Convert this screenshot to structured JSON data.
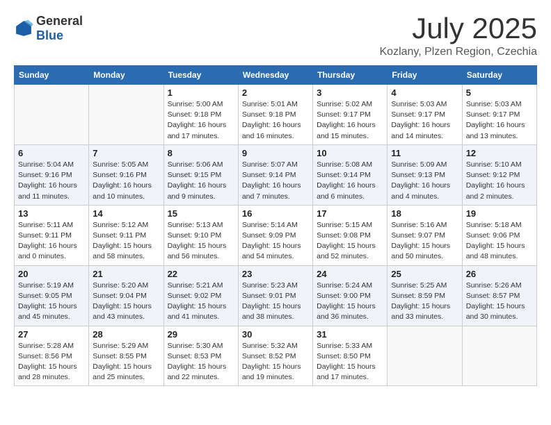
{
  "header": {
    "logo_general": "General",
    "logo_blue": "Blue",
    "month_title": "July 2025",
    "location": "Kozlany, Plzen Region, Czechia"
  },
  "weekdays": [
    "Sunday",
    "Monday",
    "Tuesday",
    "Wednesday",
    "Thursday",
    "Friday",
    "Saturday"
  ],
  "weeks": [
    [
      {
        "day": "",
        "details": ""
      },
      {
        "day": "",
        "details": ""
      },
      {
        "day": "1",
        "details": "Sunrise: 5:00 AM\nSunset: 9:18 PM\nDaylight: 16 hours\nand 17 minutes."
      },
      {
        "day": "2",
        "details": "Sunrise: 5:01 AM\nSunset: 9:18 PM\nDaylight: 16 hours\nand 16 minutes."
      },
      {
        "day": "3",
        "details": "Sunrise: 5:02 AM\nSunset: 9:17 PM\nDaylight: 16 hours\nand 15 minutes."
      },
      {
        "day": "4",
        "details": "Sunrise: 5:03 AM\nSunset: 9:17 PM\nDaylight: 16 hours\nand 14 minutes."
      },
      {
        "day": "5",
        "details": "Sunrise: 5:03 AM\nSunset: 9:17 PM\nDaylight: 16 hours\nand 13 minutes."
      }
    ],
    [
      {
        "day": "6",
        "details": "Sunrise: 5:04 AM\nSunset: 9:16 PM\nDaylight: 16 hours\nand 11 minutes."
      },
      {
        "day": "7",
        "details": "Sunrise: 5:05 AM\nSunset: 9:16 PM\nDaylight: 16 hours\nand 10 minutes."
      },
      {
        "day": "8",
        "details": "Sunrise: 5:06 AM\nSunset: 9:15 PM\nDaylight: 16 hours\nand 9 minutes."
      },
      {
        "day": "9",
        "details": "Sunrise: 5:07 AM\nSunset: 9:14 PM\nDaylight: 16 hours\nand 7 minutes."
      },
      {
        "day": "10",
        "details": "Sunrise: 5:08 AM\nSunset: 9:14 PM\nDaylight: 16 hours\nand 6 minutes."
      },
      {
        "day": "11",
        "details": "Sunrise: 5:09 AM\nSunset: 9:13 PM\nDaylight: 16 hours\nand 4 minutes."
      },
      {
        "day": "12",
        "details": "Sunrise: 5:10 AM\nSunset: 9:12 PM\nDaylight: 16 hours\nand 2 minutes."
      }
    ],
    [
      {
        "day": "13",
        "details": "Sunrise: 5:11 AM\nSunset: 9:11 PM\nDaylight: 16 hours\nand 0 minutes."
      },
      {
        "day": "14",
        "details": "Sunrise: 5:12 AM\nSunset: 9:11 PM\nDaylight: 15 hours\nand 58 minutes."
      },
      {
        "day": "15",
        "details": "Sunrise: 5:13 AM\nSunset: 9:10 PM\nDaylight: 15 hours\nand 56 minutes."
      },
      {
        "day": "16",
        "details": "Sunrise: 5:14 AM\nSunset: 9:09 PM\nDaylight: 15 hours\nand 54 minutes."
      },
      {
        "day": "17",
        "details": "Sunrise: 5:15 AM\nSunset: 9:08 PM\nDaylight: 15 hours\nand 52 minutes."
      },
      {
        "day": "18",
        "details": "Sunrise: 5:16 AM\nSunset: 9:07 PM\nDaylight: 15 hours\nand 50 minutes."
      },
      {
        "day": "19",
        "details": "Sunrise: 5:18 AM\nSunset: 9:06 PM\nDaylight: 15 hours\nand 48 minutes."
      }
    ],
    [
      {
        "day": "20",
        "details": "Sunrise: 5:19 AM\nSunset: 9:05 PM\nDaylight: 15 hours\nand 45 minutes."
      },
      {
        "day": "21",
        "details": "Sunrise: 5:20 AM\nSunset: 9:04 PM\nDaylight: 15 hours\nand 43 minutes."
      },
      {
        "day": "22",
        "details": "Sunrise: 5:21 AM\nSunset: 9:02 PM\nDaylight: 15 hours\nand 41 minutes."
      },
      {
        "day": "23",
        "details": "Sunrise: 5:23 AM\nSunset: 9:01 PM\nDaylight: 15 hours\nand 38 minutes."
      },
      {
        "day": "24",
        "details": "Sunrise: 5:24 AM\nSunset: 9:00 PM\nDaylight: 15 hours\nand 36 minutes."
      },
      {
        "day": "25",
        "details": "Sunrise: 5:25 AM\nSunset: 8:59 PM\nDaylight: 15 hours\nand 33 minutes."
      },
      {
        "day": "26",
        "details": "Sunrise: 5:26 AM\nSunset: 8:57 PM\nDaylight: 15 hours\nand 30 minutes."
      }
    ],
    [
      {
        "day": "27",
        "details": "Sunrise: 5:28 AM\nSunset: 8:56 PM\nDaylight: 15 hours\nand 28 minutes."
      },
      {
        "day": "28",
        "details": "Sunrise: 5:29 AM\nSunset: 8:55 PM\nDaylight: 15 hours\nand 25 minutes."
      },
      {
        "day": "29",
        "details": "Sunrise: 5:30 AM\nSunset: 8:53 PM\nDaylight: 15 hours\nand 22 minutes."
      },
      {
        "day": "30",
        "details": "Sunrise: 5:32 AM\nSunset: 8:52 PM\nDaylight: 15 hours\nand 19 minutes."
      },
      {
        "day": "31",
        "details": "Sunrise: 5:33 AM\nSunset: 8:50 PM\nDaylight: 15 hours\nand 17 minutes."
      },
      {
        "day": "",
        "details": ""
      },
      {
        "day": "",
        "details": ""
      }
    ]
  ]
}
